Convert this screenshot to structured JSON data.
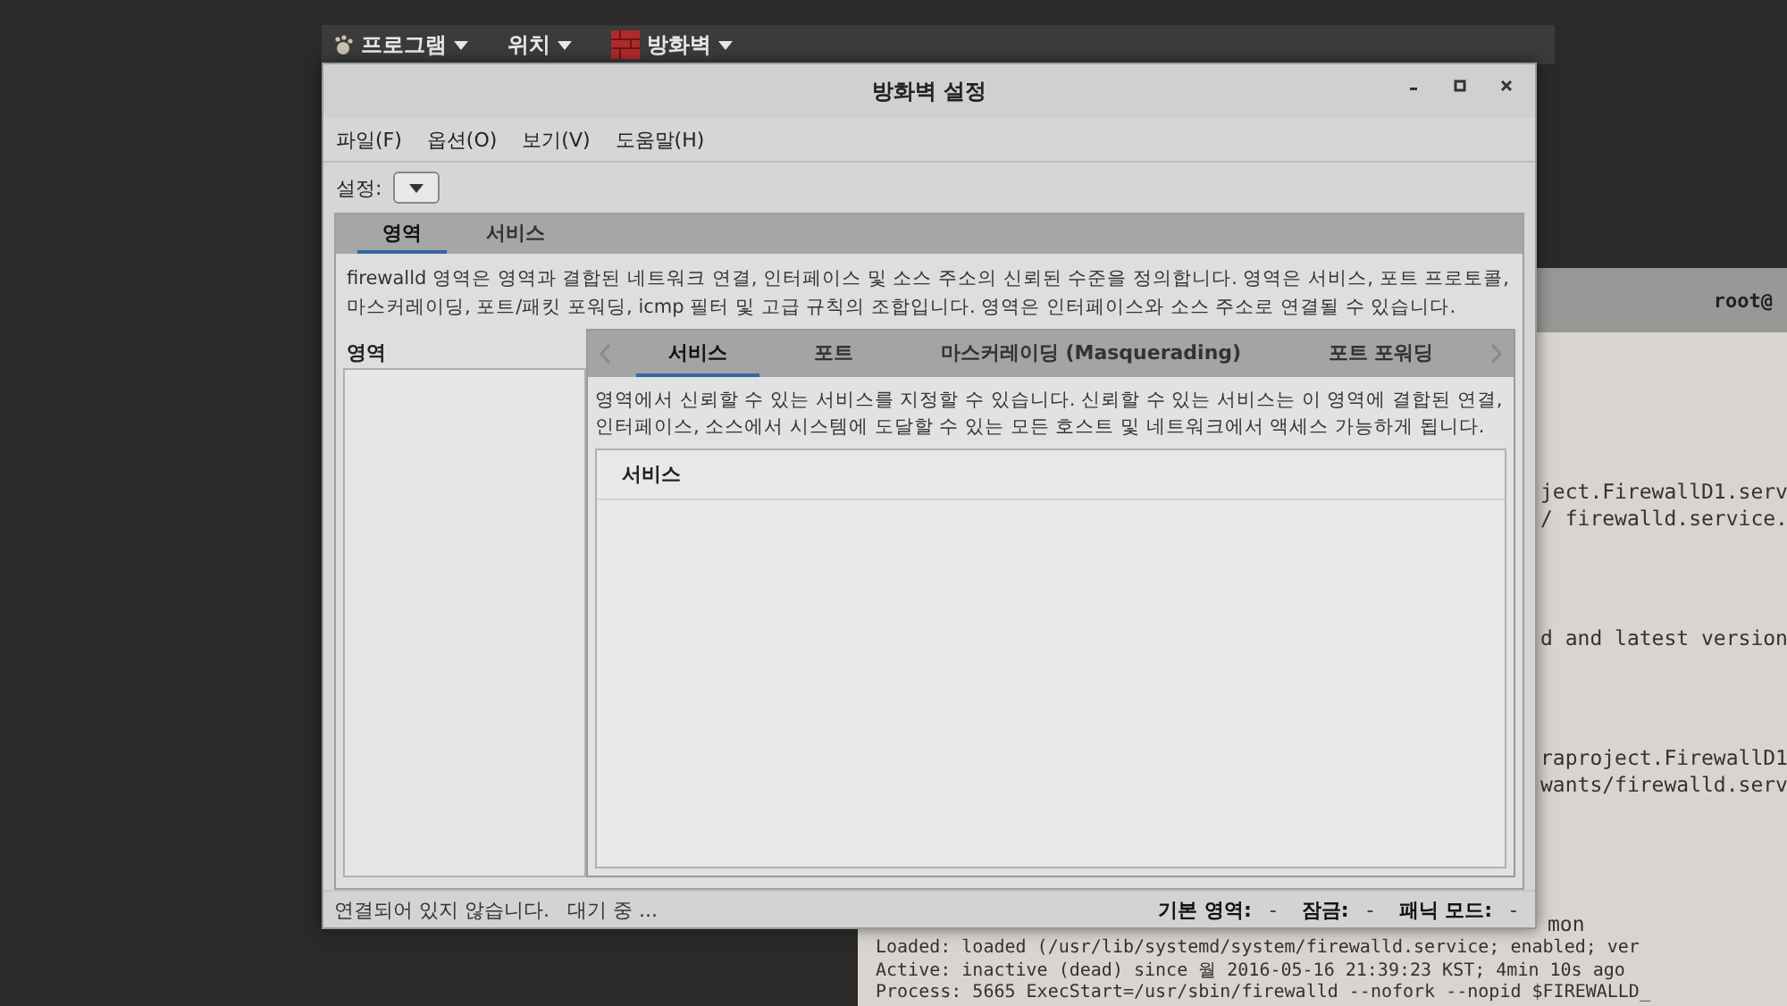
{
  "top_panel": {
    "items": [
      {
        "label": "프로그램",
        "kind": "apps"
      },
      {
        "label": "위치",
        "kind": "plain"
      },
      {
        "label": "방화벽",
        "kind": "firewall"
      }
    ]
  },
  "window": {
    "title": "방화벽 설정"
  },
  "menu": [
    "파일(F)",
    "옵션(O)",
    "보기(V)",
    "도움말(H)"
  ],
  "settings": {
    "label": "설정:"
  },
  "outer_tabs": [
    {
      "label": "영역",
      "selected": true
    },
    {
      "label": "서비스",
      "selected": false
    }
  ],
  "zone_description": "firewalld 영역은 영역과 결합된 네트워크 연결, 인터페이스 및 소스 주소의 신뢰된 수준을 정의합니다. 영역은 서비스, 포트 프로토콜, 마스커레이딩, 포트/패킷 포워딩, icmp 필터 및 고급 규칙의 조합입니다. 영역은 인터페이스와 소스 주소로 연결될 수 있습니다.",
  "zone_list": {
    "heading": "영역"
  },
  "inner_tabs": [
    {
      "label": "서비스",
      "selected": true
    },
    {
      "label": "포트",
      "selected": false
    },
    {
      "label": "마스커레이딩 (Masquerading)",
      "selected": false
    },
    {
      "label": "포트 포워딩",
      "selected": false
    }
  ],
  "service_description": "영역에서 신뢰할 수 있는 서비스를 지정할 수 있습니다. 신뢰할 수 있는 서비스는 이 영역에 결합된 연결, 인터페이스, 소스에서 시스템에 도달할 수 있는 모든 호스트 및 네트워크에서 액세스 가능하게 됩니다.",
  "service_table": {
    "columns": [
      "서비스"
    ]
  },
  "status_bar": {
    "connection": "연결되어 있지 않습니다.",
    "state": "대기 중 ...",
    "fields": [
      {
        "label": "기본 영역:",
        "value": "-"
      },
      {
        "label": "잠금:",
        "value": "-"
      },
      {
        "label": "패닉 모드:",
        "value": "-"
      }
    ]
  },
  "terminal": {
    "title": "root@",
    "side_groups": [
      [
        "ject.FirewallD1.serv",
        "/ firewalld.service."
      ],
      [
        "d and latest version"
      ],
      [
        "raproject.FirewallD1",
        "wants/firewalld.serv"
      ]
    ],
    "side_last": "mon",
    "lines": [
      "Loaded: loaded (/usr/lib/systemd/system/firewalld.service; enabled; ver",
      "Active: inactive (dead) since 월 2016-05-16 21:39:23 KST; 4min 10s ago",
      "Process: 5665 ExecStart=/usr/sbin/firewalld --nofork --nopid $FIREWALLD_"
    ]
  }
}
